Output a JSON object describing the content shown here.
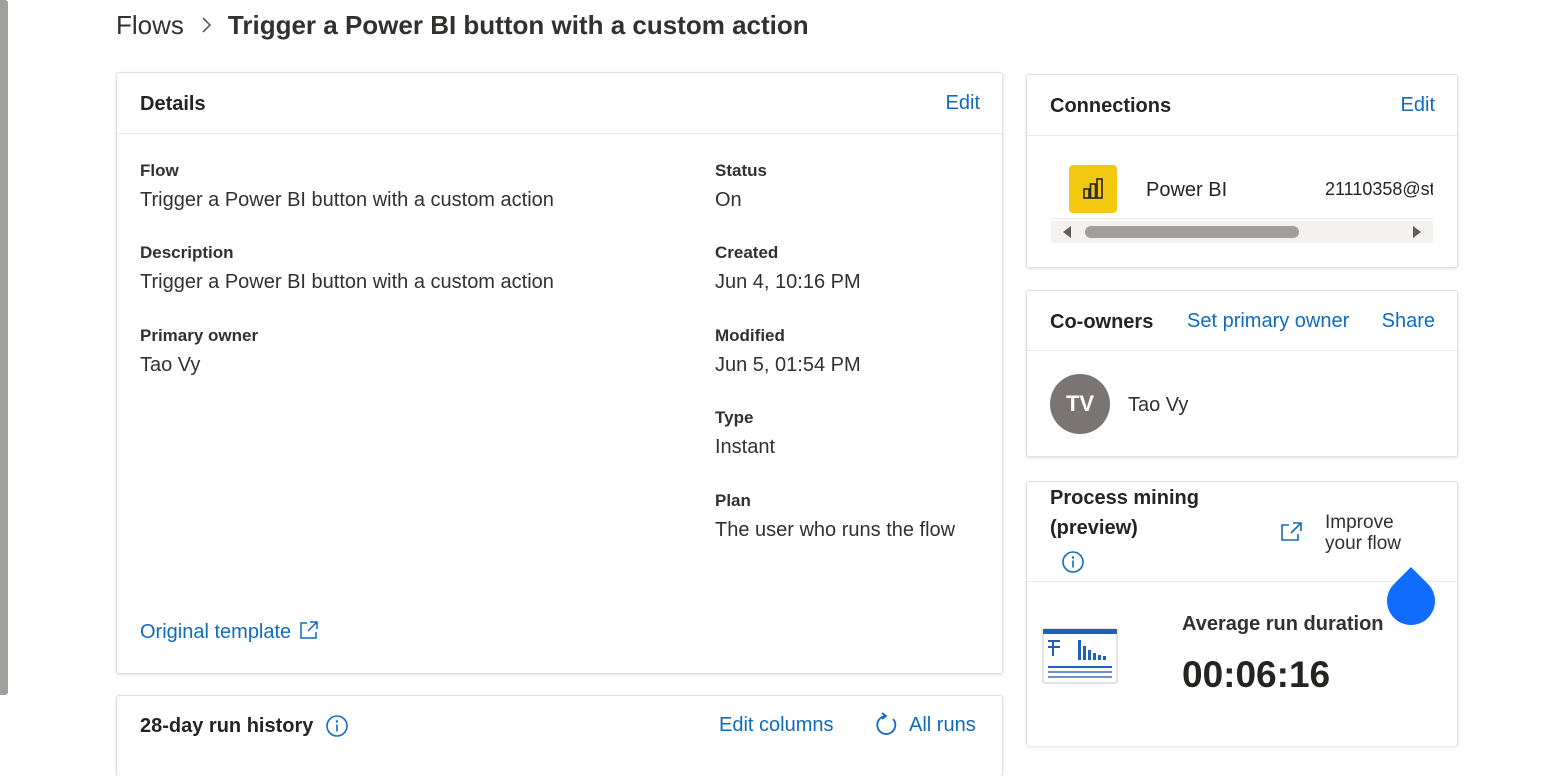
{
  "breadcrumb": {
    "root": "Flows",
    "current": "Trigger a Power BI button with a custom action"
  },
  "details": {
    "title": "Details",
    "edit_label": "Edit",
    "flow_label": "Flow",
    "flow_value": "Trigger a Power BI button with a custom action",
    "description_label": "Description",
    "description_value": "Trigger a Power BI button with a custom action",
    "owner_label": "Primary owner",
    "owner_value": "Tao Vy",
    "status_label": "Status",
    "status_value": "On",
    "created_label": "Created",
    "created_value": "Jun 4, 10:16 PM",
    "modified_label": "Modified",
    "modified_value": "Jun 5, 01:54 PM",
    "type_label": "Type",
    "type_value": "Instant",
    "plan_label": "Plan",
    "plan_value": "The user who runs the flow",
    "template_link": "Original template"
  },
  "history": {
    "title": "28-day run history",
    "edit_columns": "Edit columns",
    "all_runs": "All runs"
  },
  "connections": {
    "title": "Connections",
    "edit_label": "Edit",
    "item_name": "Power BI",
    "item_account": "21110358@st",
    "icon": "power-bi-icon"
  },
  "coowners": {
    "title": "Co-owners",
    "set_primary": "Set primary owner",
    "share": "Share",
    "avatar_initials": "TV",
    "owner_name": "Tao Vy"
  },
  "mining": {
    "title_line1": "Process mining",
    "title_line2": "(preview)",
    "improve_line1": "Improve",
    "improve_line2": "your flow",
    "metric_label": "Average run duration",
    "metric_value": "00:06:16"
  },
  "colors": {
    "accent": "#0f6cbd",
    "powerbi": "#f2c811",
    "avatar": "#7a7574",
    "drop": "#0f6cff"
  }
}
